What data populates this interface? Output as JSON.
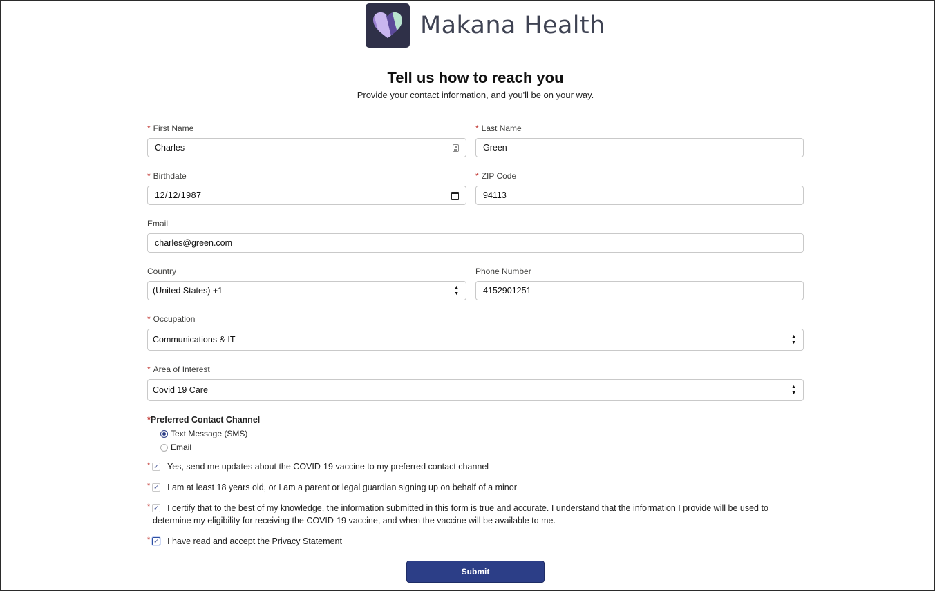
{
  "brand": {
    "name": "Makana Health",
    "logo_icon": "heart-logo-icon",
    "accent": "#2c3e87"
  },
  "page": {
    "title": "Tell us how to reach you",
    "subtitle": "Provide your contact information, and you'll be on your way."
  },
  "form": {
    "required_mark": "*",
    "first_name": {
      "label": "First Name",
      "value": "Charles"
    },
    "last_name": {
      "label": "Last Name",
      "value": "Green"
    },
    "birthdate": {
      "label": "Birthdate",
      "value": "12/12/1987"
    },
    "zip": {
      "label": "ZIP Code",
      "value": "94113"
    },
    "email": {
      "label": "Email",
      "value": "charles@green.com"
    },
    "country": {
      "label": "Country",
      "value": "(United States) +1"
    },
    "phone": {
      "label": "Phone Number",
      "value": "4152901251"
    },
    "occupation": {
      "label": "Occupation",
      "value": "Communications & IT"
    },
    "area_of_interest": {
      "label": "Area of Interest",
      "value": "Covid 19 Care"
    },
    "contact_channel": {
      "label": "Preferred Contact Channel",
      "options": [
        {
          "label": "Text Message (SMS)",
          "selected": true
        },
        {
          "label": "Email",
          "selected": false
        }
      ]
    },
    "consents": [
      {
        "text": "Yes, send me updates about the COVID-19 vaccine to my preferred contact channel",
        "checked": true
      },
      {
        "text": "I am at least 18 years old, or I am a parent or legal guardian signing up on behalf of a minor",
        "checked": true
      },
      {
        "text": "I certify that to the best of my knowledge, the information submitted in this form is true and accurate. I understand that the information I provide will be used to determine my eligibility for receiving the COVID-19 vaccine, and when the vaccine will be available to me.",
        "checked": true
      },
      {
        "text": "I have read and accept the Privacy Statement",
        "checked": true
      }
    ],
    "submit_label": "Submit"
  }
}
